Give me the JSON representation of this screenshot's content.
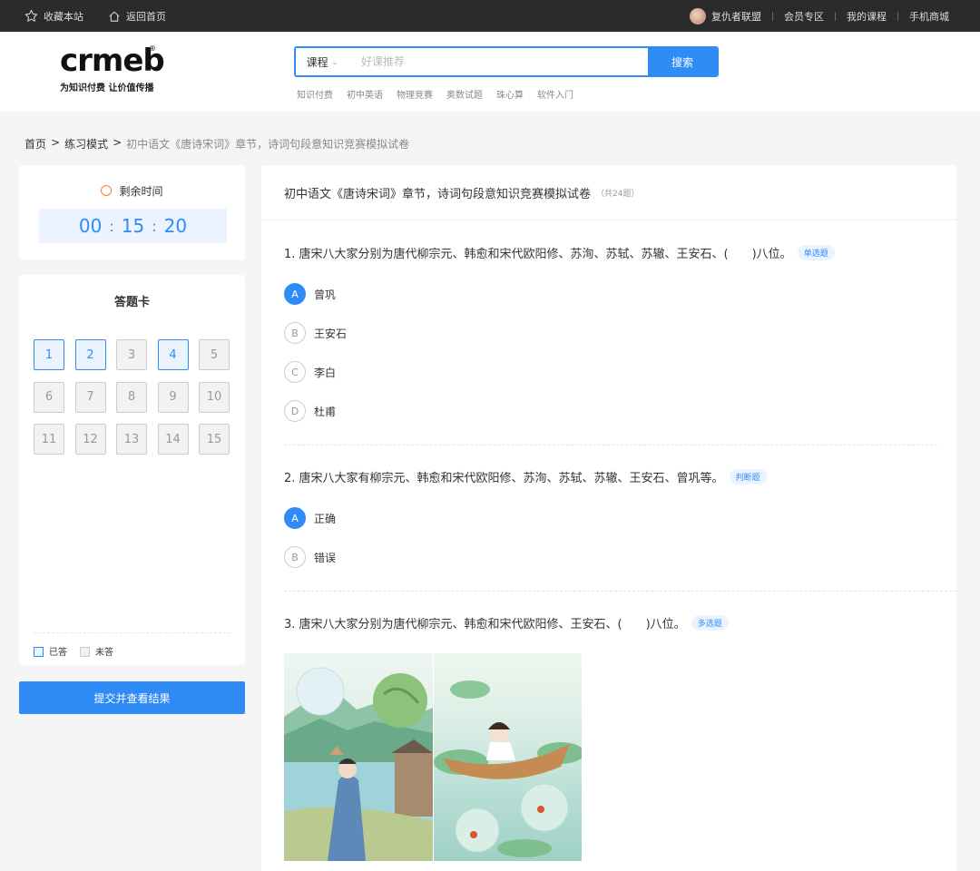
{
  "topbar": {
    "favorite": "收藏本站",
    "home": "返回首页",
    "user": "复仇者联盟",
    "links": [
      "会员专区",
      "我的课程",
      "手机商城"
    ]
  },
  "logo": {
    "mark": "crmeb",
    "reg": "®",
    "slogan": "为知识付费 让价值传播"
  },
  "search": {
    "category": "课程",
    "placeholder": "好课推荐",
    "button": "搜索",
    "hot": [
      "知识付费",
      "初中英语",
      "物理竞赛",
      "奥数试题",
      "珠心算",
      "软件入门"
    ]
  },
  "breadcrumb": {
    "home": "首页",
    "sep": ">",
    "mode": "练习模式",
    "current": "初中语文《唐诗宋词》章节，诗词句段意知识竞赛模拟试卷"
  },
  "timer": {
    "label": "剩余时间",
    "h": "00",
    "m": "15",
    "s": "20",
    "colon": ":"
  },
  "answer_card": {
    "title": "答题卡",
    "numbers": [
      "1",
      "2",
      "3",
      "4",
      "5",
      "6",
      "7",
      "8",
      "9",
      "10",
      "11",
      "12",
      "13",
      "14",
      "15"
    ],
    "answered": [
      1,
      2,
      4
    ],
    "legend_done": "已答",
    "legend_todo": "未答"
  },
  "submit": "提交并查看结果",
  "paper": {
    "title": "初中语文《唐诗宋词》章节，诗词句段意知识竞赛模拟试卷",
    "count": "（共24题）",
    "questions": [
      {
        "text": "1. 唐宋八大家分别为唐代柳宗元、韩愈和宋代欧阳修、苏洵、苏轼、苏辙、王安石、(　　)八位。",
        "tag": "单选题",
        "options": [
          {
            "letter": "A",
            "text": "曾巩",
            "selected": true
          },
          {
            "letter": "B",
            "text": "王安石",
            "selected": false
          },
          {
            "letter": "C",
            "text": "李白",
            "selected": false
          },
          {
            "letter": "D",
            "text": "杜甫",
            "selected": false
          }
        ]
      },
      {
        "text": "2. 唐宋八大家有柳宗元、韩愈和宋代欧阳修、苏洵、苏轼、苏辙、王安石、曾巩等。",
        "tag": "判断题",
        "options": [
          {
            "letter": "A",
            "text": "正确",
            "selected": true
          },
          {
            "letter": "B",
            "text": "错误",
            "selected": false
          }
        ]
      },
      {
        "text": "3. 唐宋八大家分别为唐代柳宗元、韩愈和宋代欧阳修、王安石、(　　)八位。",
        "tag": "多选题"
      }
    ]
  },
  "colors": {
    "accent": "#2f8cf7",
    "accent_light": "#eaf3fe",
    "timer_icon": "#f5822a",
    "topbar": "#2b2b2b"
  },
  "icons": [
    "star-icon",
    "home-icon",
    "avatar",
    "chevron-down-icon",
    "alarm-clock-icon"
  ]
}
